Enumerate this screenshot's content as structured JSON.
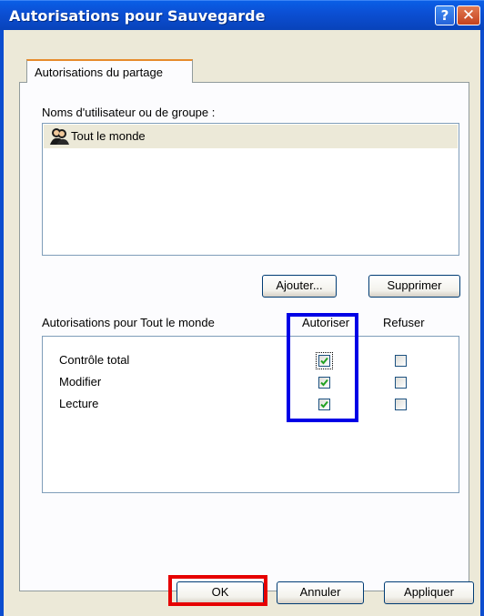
{
  "window": {
    "title": "Autorisations pour Sauvegarde",
    "help_glyph": "?",
    "close_glyph": "✕"
  },
  "tabs": [
    {
      "label": "Autorisations du partage",
      "selected": true
    }
  ],
  "users": {
    "label": "Noms d'utilisateur ou de groupe :",
    "items": [
      {
        "name": "Tout le monde",
        "icon": "user-group-icon",
        "selected": true
      }
    ],
    "add_button": "Ajouter...",
    "remove_button": "Supprimer"
  },
  "permissions": {
    "label": "Autorisations pour Tout le monde",
    "allow_header": "Autoriser",
    "deny_header": "Refuser",
    "rows": [
      {
        "name": "Contrôle total",
        "allow": true,
        "deny": false
      },
      {
        "name": "Modifier",
        "allow": true,
        "deny": false
      },
      {
        "name": "Lecture",
        "allow": true,
        "deny": false
      }
    ]
  },
  "footer": {
    "ok": "OK",
    "cancel": "Annuler",
    "apply": "Appliquer"
  },
  "colors": {
    "titlebar": "#0b4fd4",
    "dialog_bg": "#ece9d8",
    "highlight_blue": "#0000e6",
    "highlight_red": "#e60000",
    "check_green": "#21a121"
  }
}
